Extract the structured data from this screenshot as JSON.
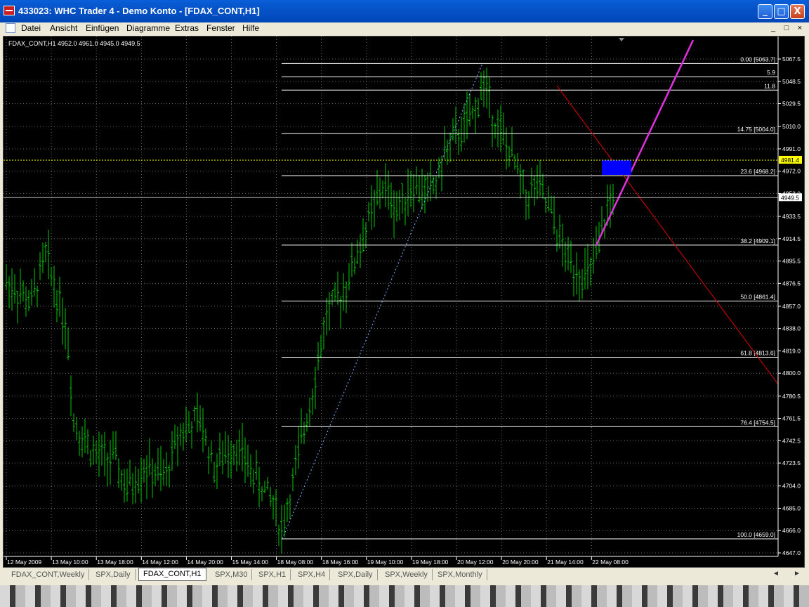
{
  "window": {
    "title": "433023: WHC Trader 4 - Demo Konto - [FDAX_CONT,H1]",
    "controls": {
      "minimize": "_",
      "maximize": "□",
      "close": "X"
    }
  },
  "menu": [
    "Datei",
    "Ansicht",
    "Einfügen",
    "Diagramme",
    "Extras",
    "Fenster",
    "Hilfe"
  ],
  "mdi_controls": [
    "_",
    "□",
    "×"
  ],
  "chart": {
    "header": "FDAX_CONT,H1  4952.0 4961.0 4945.0 4949.5",
    "price_labels": [
      "5067.5",
      "5048.5",
      "5029.5",
      "5010.0",
      "4991.0",
      "4972.0",
      "4953.0",
      "4933.5",
      "4914.5",
      "4895.5",
      "4876.5",
      "4857.0",
      "4838.0",
      "4819.0",
      "4800.0",
      "4780.5",
      "4761.5",
      "4742.5",
      "4723.5",
      "4704.0",
      "4685.0",
      "4666.0",
      "4647.0"
    ],
    "time_labels": [
      "12 May 2009",
      "13 May 10:00",
      "13 May 18:00",
      "14 May 12:00",
      "14 May 20:00",
      "15 May 14:00",
      "18 May 08:00",
      "18 May 16:00",
      "19 May 10:00",
      "19 May 18:00",
      "20 May 12:00",
      "20 May 20:00",
      "21 May 14:00",
      "22 May 08:00"
    ],
    "fib_levels": [
      {
        "label": "0.00  [5063.7]",
        "price": 5063.7
      },
      {
        "label": "5.9",
        "price": 5052.4
      },
      {
        "label": "11.8",
        "price": 5041.0
      },
      {
        "label": "14.75  [5004.0]",
        "price": 5004.0
      },
      {
        "label": "23.6  [4968.2]",
        "price": 4968.2
      },
      {
        "label": "38.2  [4909.1]",
        "price": 4909.1
      },
      {
        "label": "50.0  [4861.4]",
        "price": 4861.4
      },
      {
        "label": "61.8  [4813.6]",
        "price": 4813.6
      },
      {
        "label": "76.4  [4754.5]",
        "price": 4754.5
      },
      {
        "label": "100.0  [4659.0]",
        "price": 4659.0
      }
    ],
    "current_bid": "4949.5",
    "yellow_line": "4981.4",
    "colors": {
      "bars": "#00c800",
      "fib": "#ffffff",
      "trend_red": "#e00000",
      "trend_magenta": "#e030e0",
      "highlight": "#0000ff",
      "bid_box": "#ffffff",
      "yellow": "#ffff00"
    }
  },
  "tabs": [
    "FDAX_CONT,Weekly",
    "SPX,Daily",
    "FDAX_CONT,H1",
    "SPX,M30",
    "SPX,H1",
    "SPX,H4",
    "SPX,Daily",
    "SPX,Weekly",
    "SPX,Monthly"
  ],
  "active_tab": "FDAX_CONT,H1",
  "tab_arrows": [
    "◄",
    "►"
  ]
}
